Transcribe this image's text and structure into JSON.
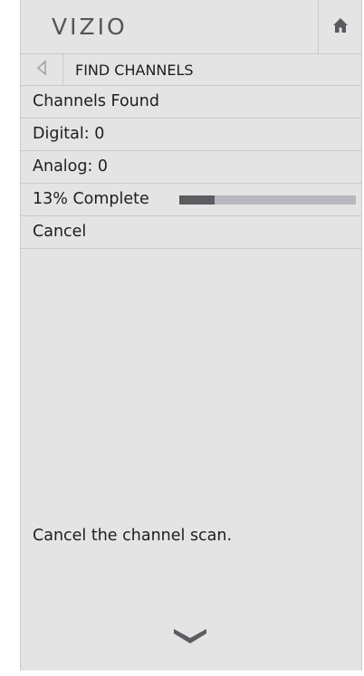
{
  "header": {
    "brand": "VIZIO",
    "home_icon": "home-icon"
  },
  "nav": {
    "back_icon": "back-arrow-icon",
    "title": "FIND CHANNELS"
  },
  "menu": {
    "channels_found": "Channels Found",
    "digital": "Digital: 0",
    "analog": "Analog: 0",
    "progress_label": "13% Complete",
    "progress_value": 0.2,
    "cancel": "Cancel"
  },
  "help_text": "Cancel the channel scan.",
  "scroll_icon": "chevron-down-icon",
  "colors": {
    "panel_bg": "#e4e4e5",
    "progress_fill": "#5c5c61",
    "progress_track": "#b7b8bd"
  }
}
